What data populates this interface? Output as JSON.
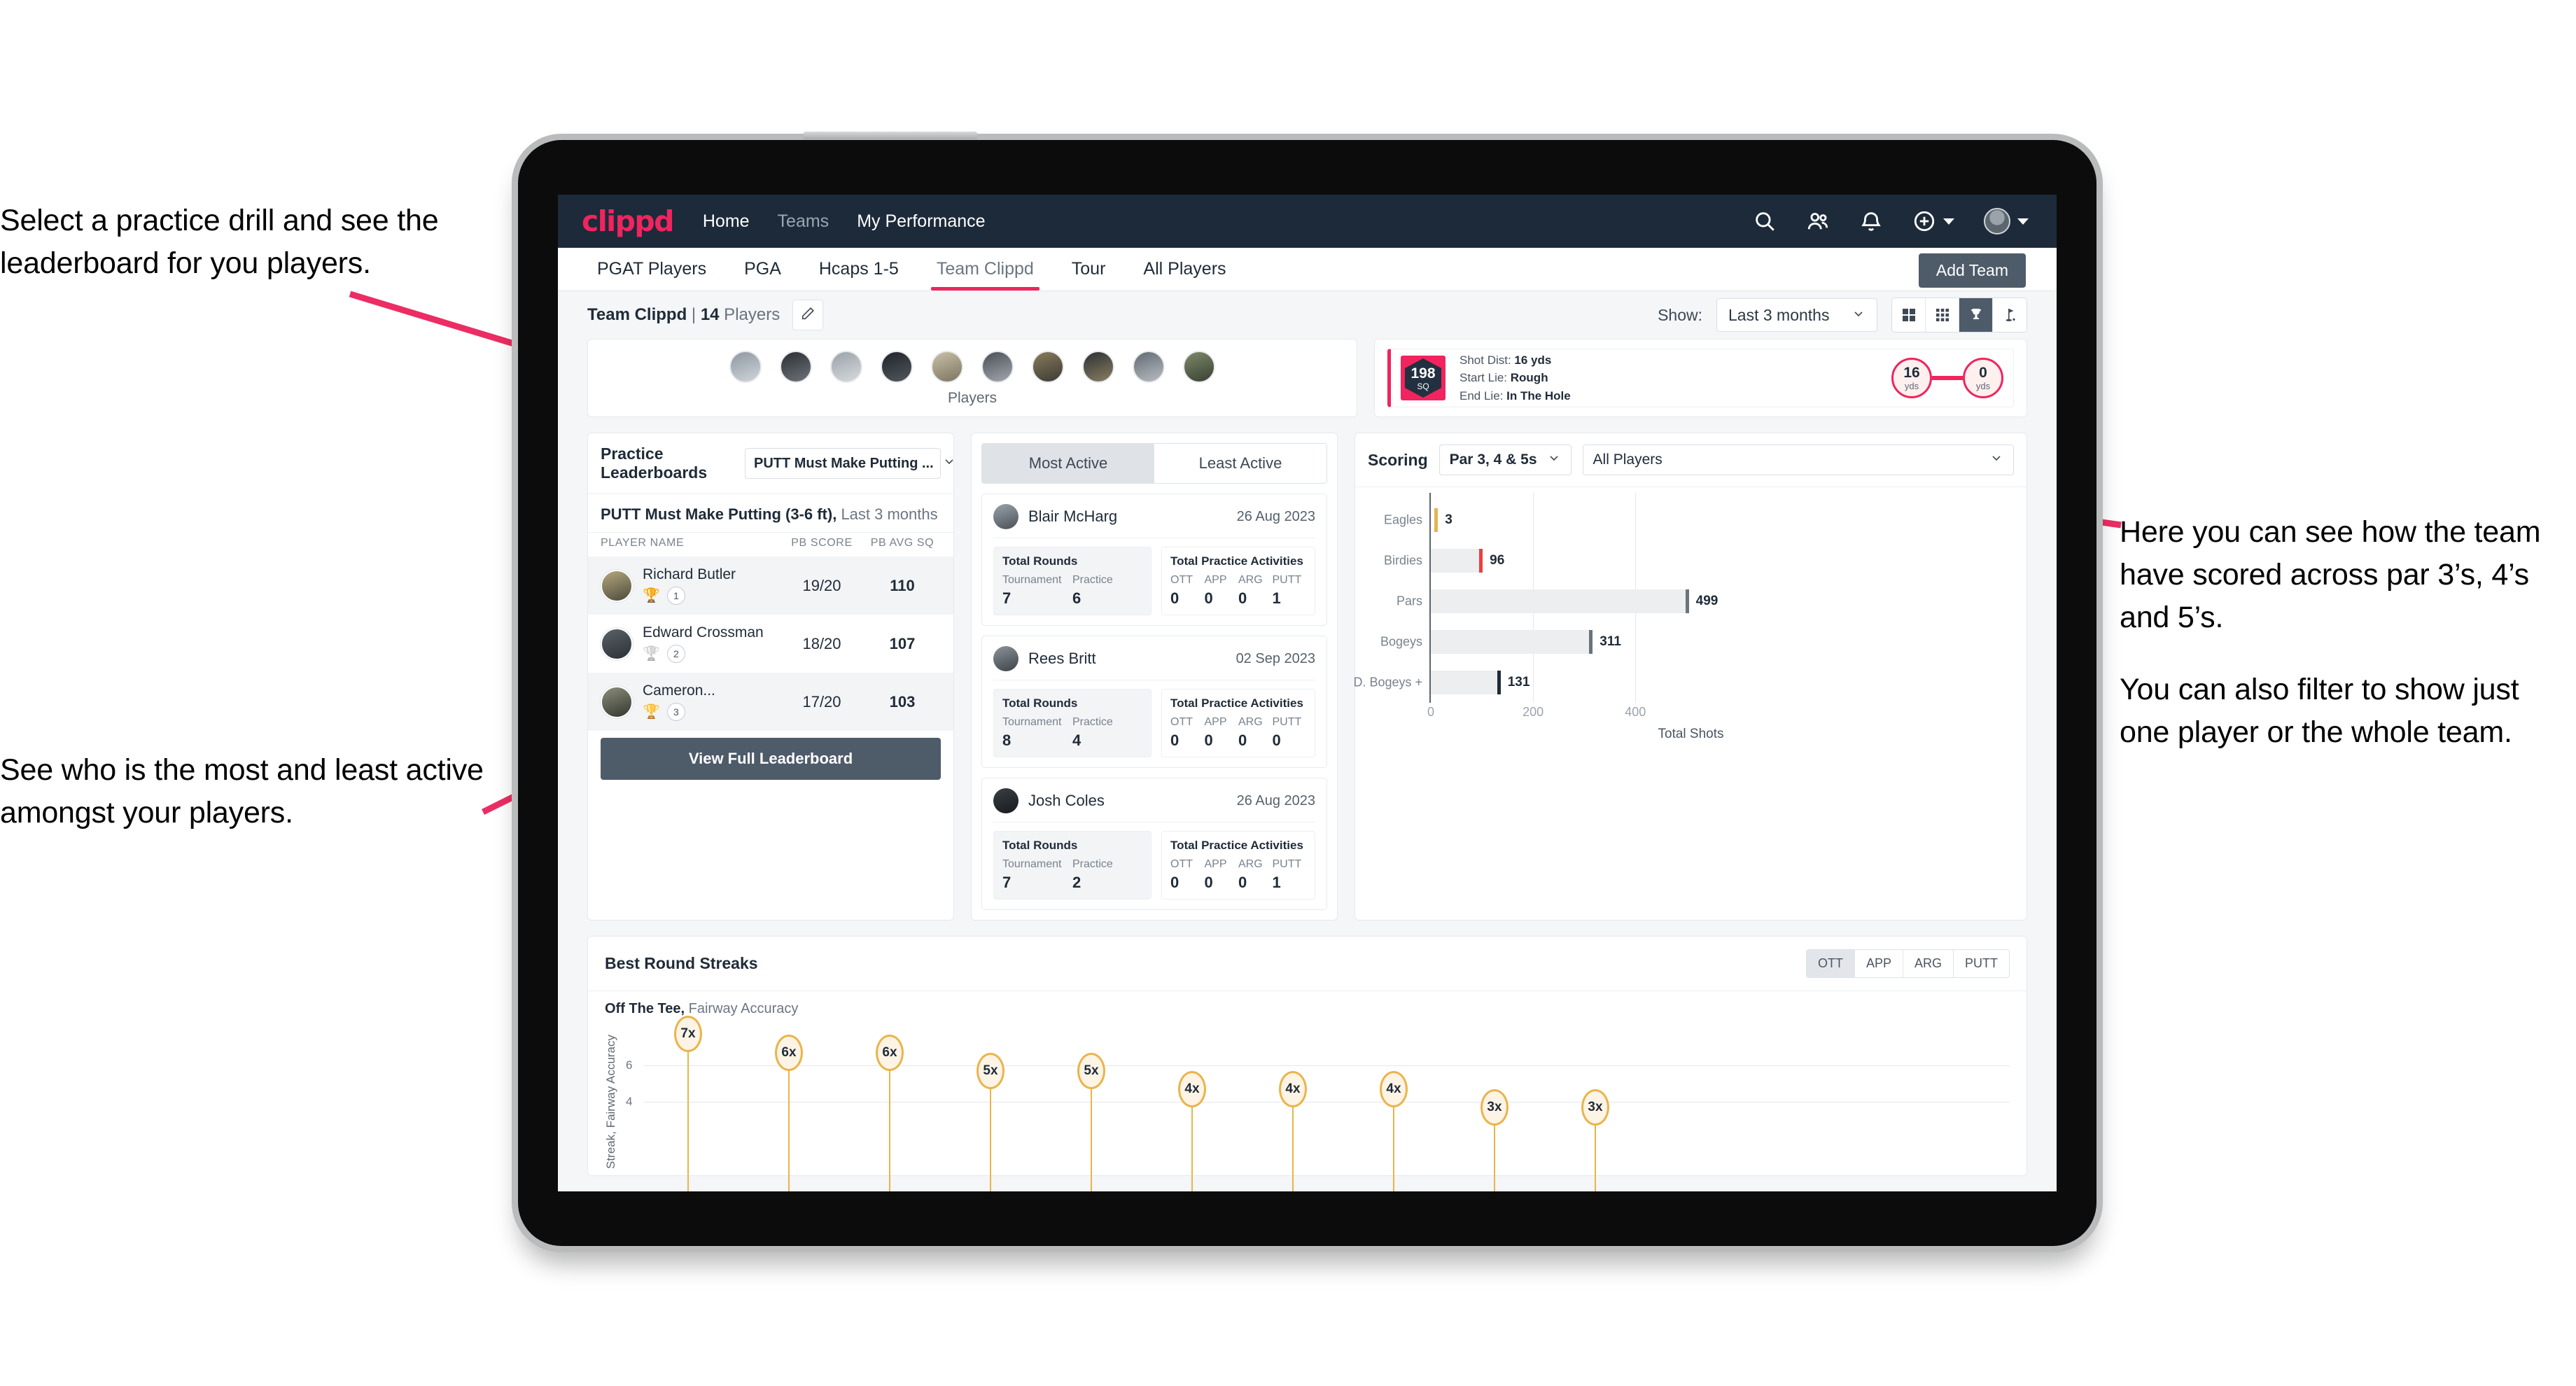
{
  "annotations": {
    "top_left": "Select a practice drill and see the leaderboard for you players.",
    "bottom_left": "See who is the most and least active amongst your players.",
    "right_1": "Here you can see how the team have scored across par 3’s, 4’s and 5’s.",
    "right_2": "You can also filter to show just one player or the whole team."
  },
  "navbar": {
    "brand": "clippd",
    "links": [
      {
        "label": "Home",
        "dim": false
      },
      {
        "label": "Teams",
        "dim": true
      },
      {
        "label": "My Performance",
        "dim": false
      }
    ],
    "icons": [
      "search-icon",
      "people-icon",
      "bell-icon",
      "plus-circle-icon",
      "avatar"
    ]
  },
  "subnav": {
    "tabs": [
      {
        "label": "PGAT Players",
        "active": false
      },
      {
        "label": "PGA",
        "active": false
      },
      {
        "label": "Hcaps 1-5",
        "active": false
      },
      {
        "label": "Team Clippd",
        "active": true
      },
      {
        "label": "Tour",
        "active": false
      },
      {
        "label": "All Players",
        "active": false
      }
    ],
    "add_team_label": "Add Team"
  },
  "teambar": {
    "team_name": "Team Clippd",
    "separator": " | ",
    "player_count": "14",
    "players_word": " Players",
    "edit_icon": "pencil-icon",
    "show_label": "Show:",
    "show_value": "Last 3 months",
    "view_toggles": [
      {
        "name": "grid-large-icon",
        "active": false
      },
      {
        "name": "grid-small-icon",
        "active": false
      },
      {
        "name": "trophy-icon",
        "active": true
      },
      {
        "name": "flag-icon",
        "active": false
      }
    ]
  },
  "players_strip": {
    "label": "Players",
    "count": 10
  },
  "shot_card": {
    "badge_number": "198",
    "badge_unit": "SQ",
    "lines": [
      {
        "k": "Shot Dist: ",
        "v": "16 yds"
      },
      {
        "k": "Start Lie: ",
        "v": "Rough"
      },
      {
        "k": "End Lie: ",
        "v": "In The Hole"
      }
    ],
    "start_value": "16",
    "start_unit": "yds",
    "end_value": "0",
    "end_unit": "yds"
  },
  "leaderboard": {
    "title": "Practice Leaderboards",
    "drill_select": "PUTT Must Make Putting ...",
    "subtitle_bold": "PUTT Must Make Putting (3-6 ft),",
    "subtitle_grey": " Last 3 months",
    "columns": [
      "PLAYER NAME",
      "PB SCORE",
      "PB AVG SQ"
    ],
    "rows": [
      {
        "name": "Richard Butler",
        "rank": "1",
        "trophy": "gold",
        "pb_score": "19/20",
        "pb_avg_sq": "110"
      },
      {
        "name": "Edward Crossman",
        "rank": "2",
        "trophy": "silver",
        "pb_score": "18/20",
        "pb_avg_sq": "107"
      },
      {
        "name": "Cameron...",
        "rank": "3",
        "trophy": "bronze",
        "pb_score": "17/20",
        "pb_avg_sq": "103"
      }
    ],
    "view_full_label": "View Full Leaderboard"
  },
  "activity": {
    "tabs": [
      {
        "label": "Most Active",
        "active": true
      },
      {
        "label": "Least Active",
        "active": false
      }
    ],
    "rounds_title": "Total Rounds",
    "practice_title": "Total Practice Activities",
    "rounds_keys": [
      "Tournament",
      "Practice"
    ],
    "practice_keys": [
      "OTT",
      "APP",
      "ARG",
      "PUTT"
    ],
    "players": [
      {
        "name": "Blair McHarg",
        "date": "26 Aug 2023",
        "rounds": [
          "7",
          "6"
        ],
        "practice": [
          "0",
          "0",
          "0",
          "1"
        ]
      },
      {
        "name": "Rees Britt",
        "date": "02 Sep 2023",
        "rounds": [
          "8",
          "4"
        ],
        "practice": [
          "0",
          "0",
          "0",
          "0"
        ]
      },
      {
        "name": "Josh Coles",
        "date": "26 Aug 2023",
        "rounds": [
          "7",
          "2"
        ],
        "practice": [
          "0",
          "0",
          "0",
          "1"
        ]
      }
    ]
  },
  "scoring": {
    "title": "Scoring",
    "par_select": "Par 3, 4 & 5s",
    "player_select": "All Players"
  },
  "streaks": {
    "title": "Best Round Streaks",
    "metric_tabs": [
      {
        "label": "OTT",
        "active": true
      },
      {
        "label": "APP",
        "active": false
      },
      {
        "label": "ARG",
        "active": false
      },
      {
        "label": "PUTT",
        "active": false
      }
    ],
    "sub_bold": "Off The Tee,",
    "sub_grey": " Fairway Accuracy"
  },
  "colors": {
    "brand_pink": "#f0245e",
    "nav_dark": "#1c2a3a",
    "button_slate": "#4e5b69",
    "gold": "#eab44b",
    "bar_grey": "#eceef0"
  },
  "chart_data": [
    {
      "type": "bar",
      "orientation": "horizontal",
      "title": "Scoring",
      "categories": [
        "Eagles",
        "Birdies",
        "Pars",
        "Bogeys",
        "D. Bogeys +"
      ],
      "values": [
        3,
        96,
        499,
        311,
        131
      ],
      "cap_colors": [
        "#eab44b",
        "#e8413f",
        "#6b737b",
        "#6b737b",
        "#1f2b38"
      ],
      "xlabel": "Total Shots",
      "ylabel": "",
      "xlim": [
        0,
        520
      ],
      "xticks": [
        0,
        200,
        400
      ],
      "grid": true,
      "legend": "none"
    },
    {
      "type": "scatter",
      "subtype": "lollipop",
      "title": "Best Round Streaks",
      "series_label": "Off The Tee, Fairway Accuracy",
      "ylabel": "Streak, Fairway Accuracy",
      "values": [
        7,
        6,
        6,
        5,
        5,
        4,
        4,
        4,
        3,
        3
      ],
      "value_labels": [
        "7x",
        "6x",
        "6x",
        "5x",
        "5x",
        "4x",
        "4x",
        "4x",
        "3x",
        "3x"
      ],
      "yticks": [
        4,
        6
      ],
      "ylim": [
        0,
        8
      ],
      "grid": true,
      "legend": "none"
    }
  ]
}
